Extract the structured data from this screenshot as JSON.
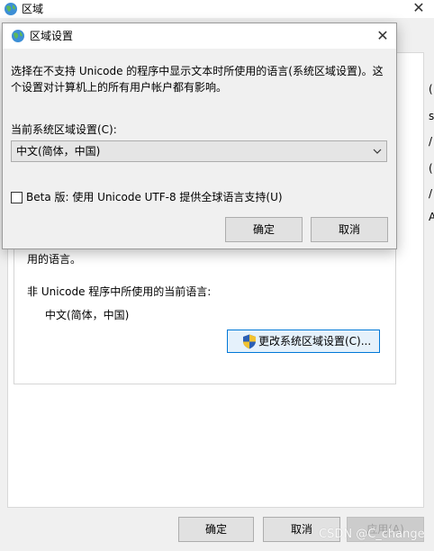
{
  "parent_window": {
    "title": "区域",
    "close_glyph": "✕",
    "title_icon": "globe-icon",
    "group_text_line": "用的语言。",
    "non_unicode_label": "非 Unicode 程序中所使用的当前语言:",
    "non_unicode_value": "中文(简体，中国)",
    "change_locale_button": "更改系统区域设置(C)...",
    "change_locale_icon": "uac-shield-icon",
    "right_edge_glyphs": [
      "(",
      "s",
      "/",
      "(",
      "/",
      "A"
    ],
    "buttons": {
      "ok": "确定",
      "cancel": "取消",
      "apply": "应用(A)"
    }
  },
  "dialog": {
    "title": "区域设置",
    "title_icon": "globe-icon",
    "close_glyph": "✕",
    "description": "选择在不支持 Unicode 的程序中显示文本时所使用的语言(系统区域设置)。这个设置对计算机上的所有用户帐户都有影响。",
    "current_locale_label": "当前系统区域设置(C):",
    "current_locale_value": "中文(简体，中国)",
    "beta_checkbox_label": "Beta 版: 使用 Unicode UTF-8 提供全球语言支持(U)",
    "beta_checked": false,
    "buttons": {
      "ok": "确定",
      "cancel": "取消"
    }
  },
  "watermark": "CSDN @C_change",
  "colors": {
    "window_bg": "#f0f0f0",
    "accent_border": "#0078d7",
    "accent_fill": "#e5f1fb"
  }
}
